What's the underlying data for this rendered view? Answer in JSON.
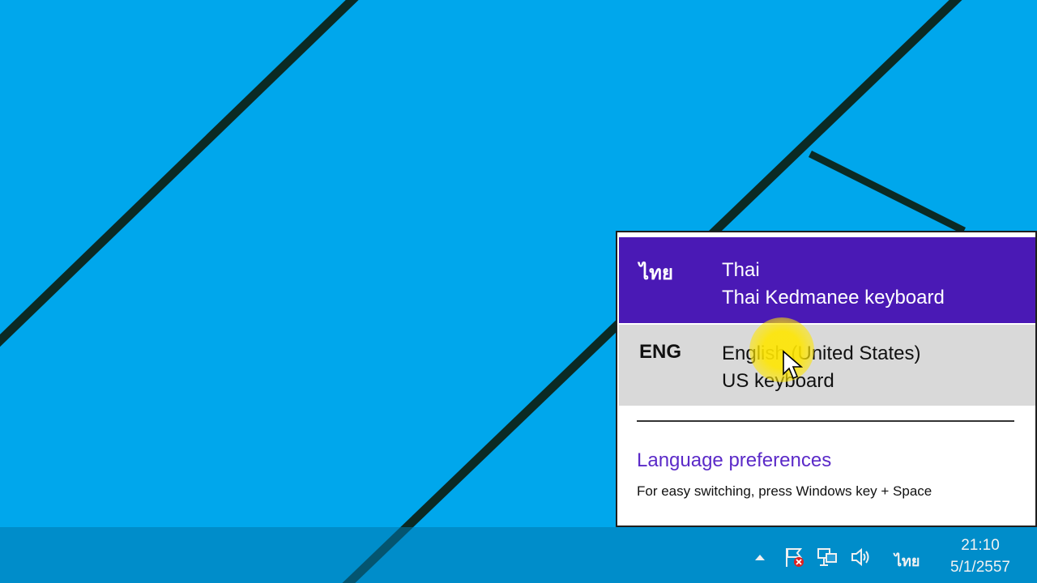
{
  "languages": [
    {
      "abbr": "ไทย",
      "name": "Thai",
      "keyboard": "Thai Kedmanee keyboard",
      "state": "selected"
    },
    {
      "abbr": "ENG",
      "name": "English (United States)",
      "keyboard": "US keyboard",
      "state": "hover"
    }
  ],
  "preferences_link": "Language preferences",
  "hint": "For easy switching, press Windows key + Space",
  "taskbar": {
    "lang_indicator": "ไทย",
    "time": "21:10",
    "date": "5/1/2557",
    "icons": [
      "show-hidden-icons-icon",
      "action-center-flag-icon",
      "network-icon",
      "volume-icon"
    ]
  },
  "colors": {
    "desktop_bg": "#00a7ec",
    "selected_bg": "#4a19b5",
    "hover_bg": "#d9d9d9",
    "link": "#5b2ac8"
  }
}
